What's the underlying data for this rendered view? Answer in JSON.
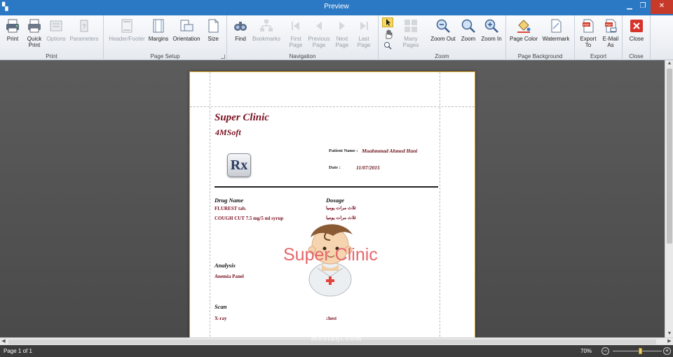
{
  "window": {
    "title": "Preview",
    "min": "▁",
    "max": "❐",
    "close": "✕"
  },
  "ribbon": {
    "groups": [
      {
        "label": "Print",
        "buttons": [
          "Print",
          "Quick\nPrint",
          "Options",
          "Parameters"
        ]
      },
      {
        "label": "Page Setup",
        "buttons": [
          "Header/Footer",
          "Margins",
          "Orientation",
          "Size"
        ]
      },
      {
        "label": "Navigation",
        "buttons": [
          "Find",
          "Bookmarks",
          "First\nPage",
          "Previous\nPage",
          "Next\nPage",
          "Last\nPage"
        ]
      },
      {
        "label": "Zoom",
        "buttons": [
          "Many Pages",
          "Zoom Out",
          "Zoom",
          "Zoom In"
        ]
      },
      {
        "label": "Page Background",
        "buttons": [
          "Page Color",
          "Watermark"
        ]
      },
      {
        "label": "Export",
        "buttons": [
          "Export\nTo",
          "E-Mail\nAs"
        ]
      },
      {
        "label": "Close",
        "buttons": [
          "Close"
        ]
      }
    ]
  },
  "document": {
    "clinic_name": "Super Clinic",
    "clinic_subtitle": "4MSoft",
    "rx_symbol": "Rx",
    "patient_name_label": "Patient Name :",
    "patient_name": "Muahmmad Ahmed Hani",
    "date_label": "Date :",
    "date": "11/07/2015",
    "drug_header": "Drug Name",
    "dosage_header": "Dosage",
    "drugs": [
      {
        "name": "FLUREST tab.",
        "dosage": "ثلاث مرات يوميا"
      },
      {
        "name": "COUGH CUT 7.5 mg/5 ml syrup",
        "dosage": "ثلاث مرات يوميا"
      }
    ],
    "analysis_header": "Analysis",
    "analysis_items": [
      "Anemia Panel"
    ],
    "scan_header": "Scan",
    "scan_items": [
      {
        "name": "X-ray",
        "note": "chest"
      }
    ],
    "watermark_text": "Super Clinic"
  },
  "brand": {
    "arabic": "مستقل",
    "latin": "mostaql.com"
  },
  "status": {
    "page_info": "Page 1 of 1",
    "zoom": "70%",
    "zoom_level": 0.55
  },
  "colors": {
    "title_bar": "#2b78c5",
    "accent_red": "#7a1020",
    "watermark": "#e4676b",
    "page_border": "#e0a928"
  }
}
